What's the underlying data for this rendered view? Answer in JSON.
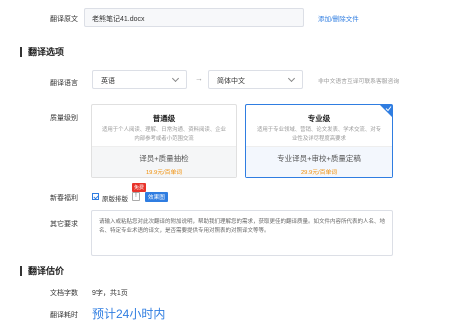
{
  "file_row": {
    "label": "翻译原文",
    "filename": "老熊笔记41.docx",
    "action_link": "添加/删除文件"
  },
  "options_section": {
    "title": "翻译选项"
  },
  "language_row": {
    "label": "翻译语言",
    "source": "英语",
    "arrow": "→",
    "target": "简体中文",
    "hint": "非中文语言互译可联系客服咨询"
  },
  "quality_row": {
    "label": "质量级别",
    "tiers": [
      {
        "title": "普通级",
        "desc": "适用于个人阅读、理解、日常沟通、资料阅读、企业内部参考或者小范围交流",
        "service": "译员+质量抽检",
        "price": "19.9元/百单词",
        "selected": false
      },
      {
        "title": "专业级",
        "desc": "适用于专业领域、营销、论文发表、学术交流、对专业性及详尽程度高要求",
        "service": "专业译员+审校+质量定稿",
        "price": "29.9元/百单词",
        "selected": true
      }
    ]
  },
  "bonus_row": {
    "label": "新春福利",
    "free_badge": "免费",
    "option_text": "原版排版",
    "warning": "!",
    "effect_link": "效果图",
    "checked": true
  },
  "requirements_row": {
    "label": "其它要求",
    "placeholder": "请输入或粘贴您对此次翻译的附加说明，帮助我们理解您的需求，获取更佳的翻译质量。如文件内容所代表的人名、地名、特定专业术语的译文，是否需要提供专用对照表的对照译文等等。"
  },
  "estimate_section": {
    "title": "翻译估价"
  },
  "doc_count_row": {
    "label": "文档字数",
    "value": "9字，共1页"
  },
  "time_row": {
    "label": "翻译耗时",
    "value": "预计24小时内"
  },
  "colors": {
    "accent": "#2f7de1",
    "price": "#f08c00",
    "badge_red": "#e8332a"
  }
}
